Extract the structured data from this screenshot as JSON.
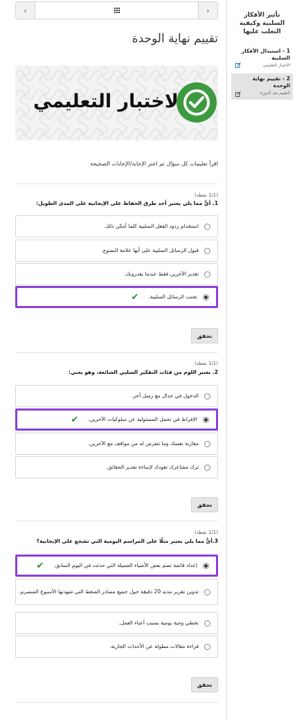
{
  "page": {
    "title": "تقييم نهاية الوحدة",
    "banner_text": "الاختبار التعليمي",
    "instructions": "اقرأ تعليمات كل سؤال ثم اختر الإجابة/الإجابات الصحيحة",
    "accent_color": "#8b3fd9",
    "check_color": "#3c9a3f"
  },
  "nav": {
    "prev_icon": "chevron-left-icon",
    "next_icon": "chevron-right-icon",
    "menu_icon": "grid-icon"
  },
  "questions": [
    {
      "points": "(1/1 نقطة)",
      "text": "1. أيٌّ مما يلي يعتبر أحد طرق الحفاظ على الإيجابية على المدى الطويل:",
      "options": [
        {
          "label": "استخدام ردود الفعل السلبية كلما أمكن ذلك.",
          "selected": false
        },
        {
          "label": "قبول الرسائل السلبية على أنها علامة النضوج.",
          "selected": false
        },
        {
          "label": "تقدير الآخرين فقط عندما يقدرونك.",
          "selected": false
        },
        {
          "label": "تجنب الرسائل السلبية.",
          "selected": true
        }
      ],
      "check_label": "تحقق"
    },
    {
      "points": "(1/1 نقطة)",
      "text": "2. يعتبر اللوم من فئات التفكير السلبي الشائعة، وهو يعني:",
      "options": [
        {
          "label": "الدخول في جدال مع زميل آخر.",
          "selected": false
        },
        {
          "label": "الإفراط في تحمل المسئولية عن سلوكيات الآخرين.",
          "selected": true
        },
        {
          "label": "مقارنة نفسك وما تتعرض له من مواقف مع الآخرين.",
          "selected": false
        },
        {
          "label": "ترك مشاعرك تقودك لإساءة تقدير الحقائق.",
          "selected": false
        }
      ],
      "check_label": "تحقق"
    },
    {
      "points": "(1/1 نقطة)",
      "text": "3.أيٌّ مما يلي يعتبر مثلًا على المراسم اليومية التي تشجع على الإيجابية؟",
      "options": [
        {
          "label": "إعداد قائمة تضم بعض الأشياء الجميلة التي حدثت في اليوم السابق.",
          "selected": true
        },
        {
          "label": "تدوين تقرير مدته 20 دقيقة حول جميع مصادر الضغط التي شهدتها الأسبوع المنصرم.",
          "selected": false
        },
        {
          "label": "تخطي وجبة يومية بسبب أعباء العمل.",
          "selected": false
        },
        {
          "label": "قراءة مقالات مطولة عن الأحداث الجارية.",
          "selected": false
        }
      ],
      "check_label": "تحقق"
    }
  ],
  "sidebar": {
    "title": "تأثير الأفكار السلبية وكيفية التغلب عليها",
    "items": [
      {
        "label": "1 - استبدال الأفكار السلبية",
        "sub": "الاختبار التعليمي",
        "active": false
      },
      {
        "label": "2 - تقييم نهاية الوحدة",
        "sub": "التقييم بعد الدورة",
        "active": true
      }
    ]
  }
}
